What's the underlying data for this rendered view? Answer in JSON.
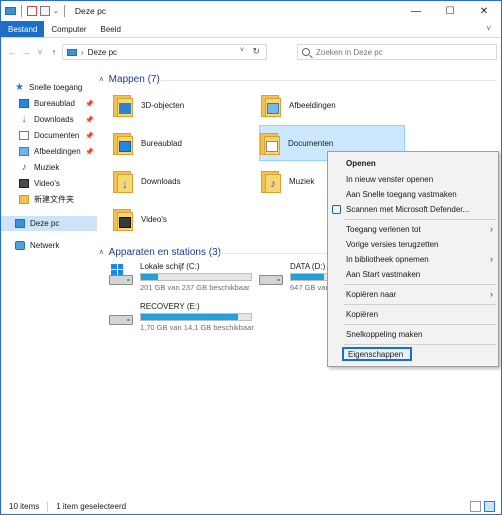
{
  "window": {
    "title": "Deze pc",
    "quick_access_drop": "⌄",
    "controls": {
      "minimize": "—",
      "maximize": "☐",
      "close": "✕"
    }
  },
  "ribbon": {
    "tabs": [
      "Bestand",
      "Computer",
      "Beeld"
    ],
    "expand_glyph": "˅"
  },
  "addressbar": {
    "back": "←",
    "forward": "→",
    "recent": "˅",
    "up": "↑",
    "chevron": "›",
    "path": "Deze pc",
    "drop": "˅",
    "refresh": "↻"
  },
  "search": {
    "placeholder": "Zoeken in Deze pc"
  },
  "sidebar": {
    "pin_glyph": "📌",
    "quick_access": "Snelle toegang",
    "items": [
      {
        "label": "Bureaublad",
        "icon": "desktop-icon",
        "pinned": true
      },
      {
        "label": "Downloads",
        "icon": "download-icon",
        "pinned": true
      },
      {
        "label": "Documenten",
        "icon": "document-icon",
        "pinned": true
      },
      {
        "label": "Afbeeldingen",
        "icon": "pictures-icon",
        "pinned": true
      },
      {
        "label": "Muziek",
        "icon": "music-icon",
        "pinned": false
      },
      {
        "label": "Video's",
        "icon": "video-icon",
        "pinned": false
      },
      {
        "label": "新建文件夹",
        "icon": "folder-icon",
        "pinned": false
      }
    ],
    "this_pc": "Deze pc",
    "network": "Netwerk"
  },
  "content": {
    "collapse_glyph": "˄",
    "folders_heading": "Mappen (7)",
    "folders": [
      {
        "label": "3D-objecten",
        "icon": "3d-objects-icon"
      },
      {
        "label": "Afbeeldingen",
        "icon": "pictures-folder-icon"
      },
      {
        "label": "Bureaublad",
        "icon": "desktop-folder-icon"
      },
      {
        "label": "Documenten",
        "icon": "documents-folder-icon",
        "selected": true
      },
      {
        "label": "Downloads",
        "icon": "downloads-folder-icon"
      },
      {
        "label": "Muziek",
        "icon": "music-folder-icon"
      },
      {
        "label": "Video's",
        "icon": "videos-folder-icon"
      }
    ],
    "drives_heading": "Apparaten en stations (3)",
    "drives": [
      {
        "name": "Lokale schijf (C:)",
        "free": "201 GB van 237 GB beschikbaar",
        "used_fraction": 0.15,
        "system": true
      },
      {
        "name": "DATA (D:)",
        "free": "647 GB van",
        "used_fraction": 0.3,
        "system": false
      },
      {
        "name": "RECOVERY (E:)",
        "free": "1,70 GB van 14,1 GB beschikbaar",
        "used_fraction": 0.88,
        "system": false
      }
    ]
  },
  "context_menu": {
    "submenu_arrow": "›",
    "items": [
      {
        "label": "Openen",
        "bold": true
      },
      {
        "label": "In nieuw venster openen"
      },
      {
        "label": "Aan Snelle toegang vastmaken"
      },
      {
        "label": "Scannen met Microsoft Defender...",
        "icon": "defender-shield-icon"
      },
      {
        "label": "Toegang verlenen tot",
        "submenu": true
      },
      {
        "label": "Vorige versies terugzetten"
      },
      {
        "label": "In bibliotheek opnemen",
        "submenu": true
      },
      {
        "label": "Aan Start vastmaken"
      },
      {
        "label": "Kopiëren naar",
        "submenu": true
      },
      {
        "label": "Kopiëren"
      },
      {
        "label": "Snelkoppeling maken"
      },
      {
        "label": "Eigenschappen",
        "highlighted": true
      }
    ]
  },
  "statusbar": {
    "items": "10 items",
    "selection": "1 item geselecteerd"
  },
  "colors": {
    "accent": "#1a6fc9",
    "selection": "#cce8ff",
    "drive_bar": "#26a0da"
  }
}
